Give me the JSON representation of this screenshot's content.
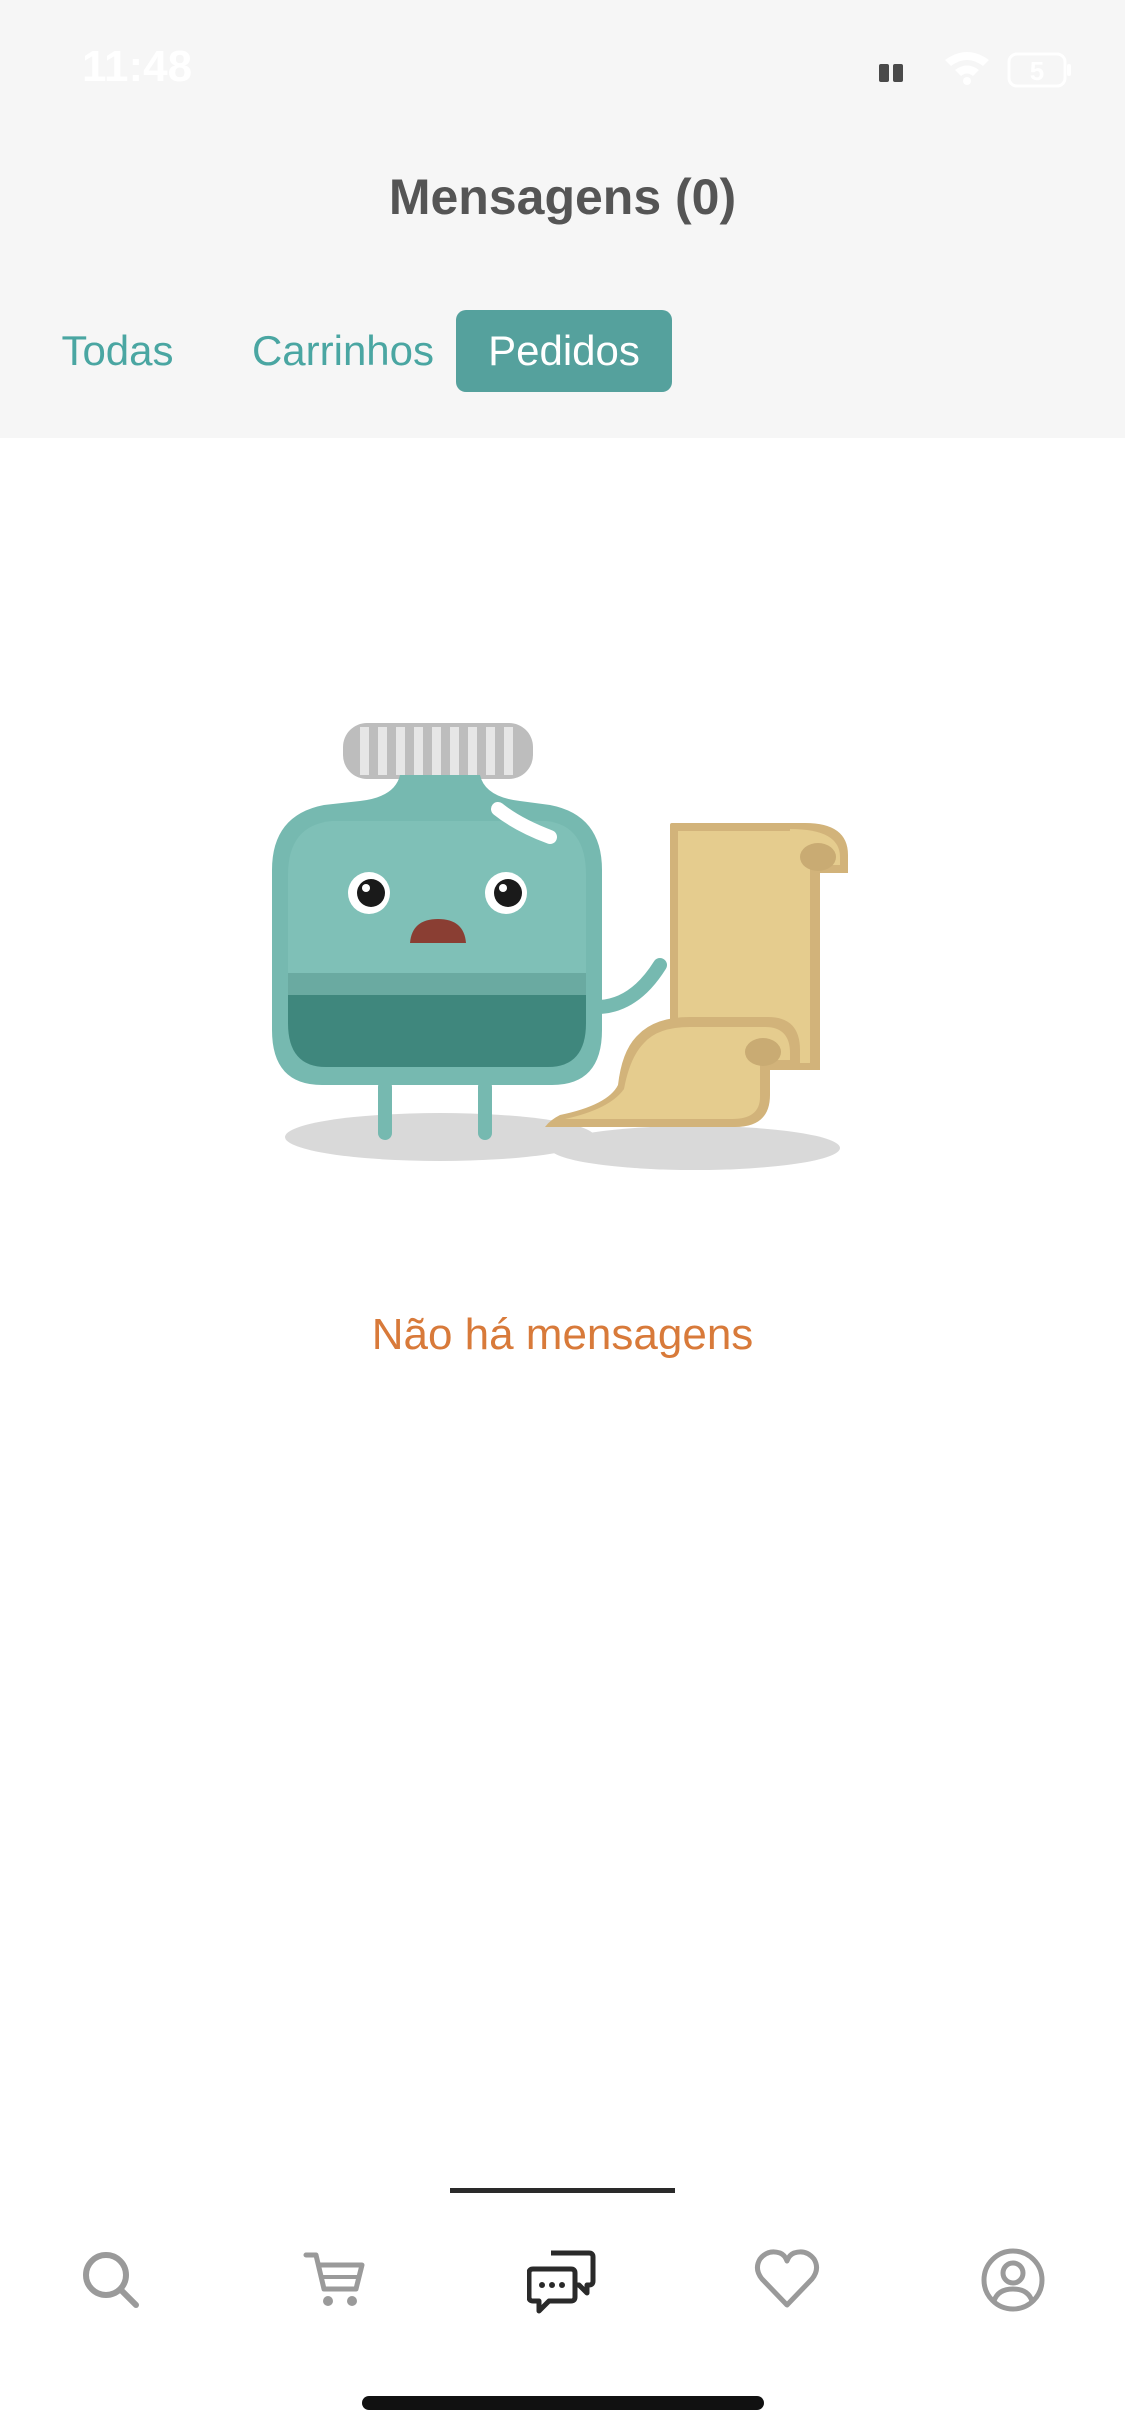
{
  "status_bar": {
    "time": "11:48",
    "battery": "5"
  },
  "header": {
    "title": "Mensagens (0)"
  },
  "tabs": [
    {
      "label": "Todas",
      "selected": false
    },
    {
      "label": "Carrinhos",
      "selected": false
    },
    {
      "label": "Pedidos",
      "selected": true
    }
  ],
  "empty_state": {
    "message": "Não há mensagens"
  },
  "bottom_nav": [
    {
      "icon": "search-icon"
    },
    {
      "icon": "cart-icon"
    },
    {
      "icon": "messages-icon",
      "active": true
    },
    {
      "icon": "heart-icon"
    },
    {
      "icon": "profile-icon"
    }
  ],
  "colors": {
    "accent": "#55a19d",
    "tab_text": "#4aa6a2",
    "empty_text": "#d87a3a",
    "header_bg": "#f6f6f6"
  }
}
